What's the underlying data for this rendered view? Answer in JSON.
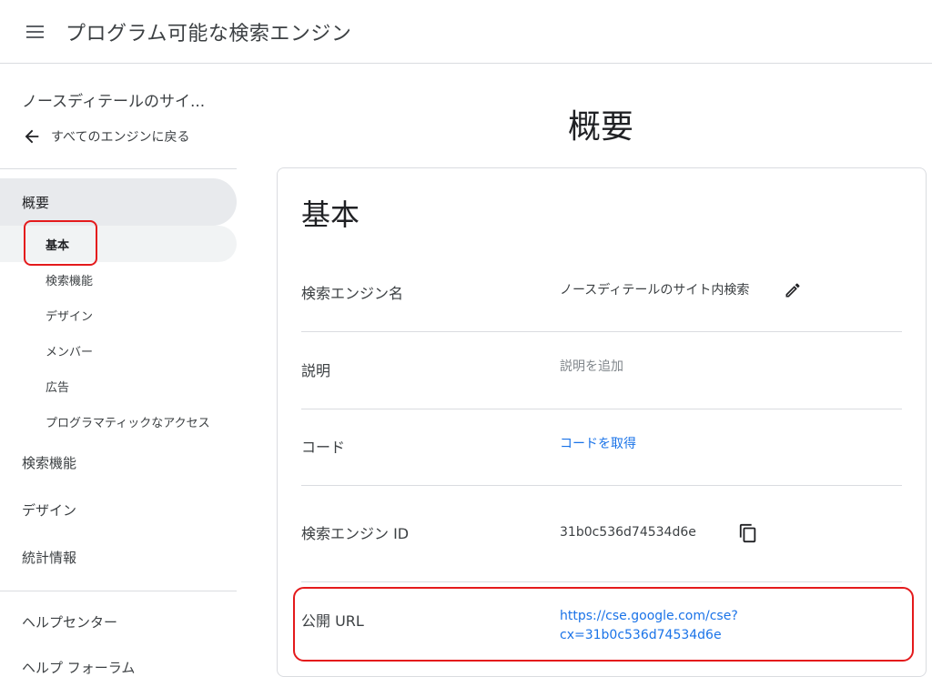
{
  "header": {
    "title": "プログラム可能な検索エンジン"
  },
  "sidebar": {
    "engine_name": "ノースディテールのサイ...",
    "back_label": "すべてのエンジンに戻る",
    "overview_label": "概要",
    "sub_items": [
      "基本",
      "検索機能",
      "デザイン",
      "メンバー",
      "広告",
      "プログラマティックなアクセス"
    ],
    "main_items": [
      "検索機能",
      "デザイン",
      "統計情報"
    ],
    "help_items": [
      "ヘルプセンター",
      "ヘルプ フォーラム"
    ]
  },
  "main": {
    "page_title": "概要",
    "card_title": "基本",
    "rows": {
      "engine_name": {
        "label": "検索エンジン名",
        "value": "ノースディテールのサイト内検索"
      },
      "description": {
        "label": "説明",
        "value": "説明を追加"
      },
      "code": {
        "label": "コード",
        "value": "コードを取得"
      },
      "engine_id": {
        "label": "検索エンジン ID",
        "value": "31b0c536d74534d6e"
      },
      "public_url": {
        "label": "公開 URL",
        "line1": "https://cse.google.com/cse?",
        "line2": "cx=31b0c536d74534d6e"
      }
    }
  },
  "colors": {
    "link": "#1a73e8",
    "highlight": "#e41a1c",
    "nav_active": "#e8eaed"
  },
  "icons": [
    "menu-icon",
    "arrow-left-icon",
    "pencil-icon",
    "copy-icon"
  ]
}
